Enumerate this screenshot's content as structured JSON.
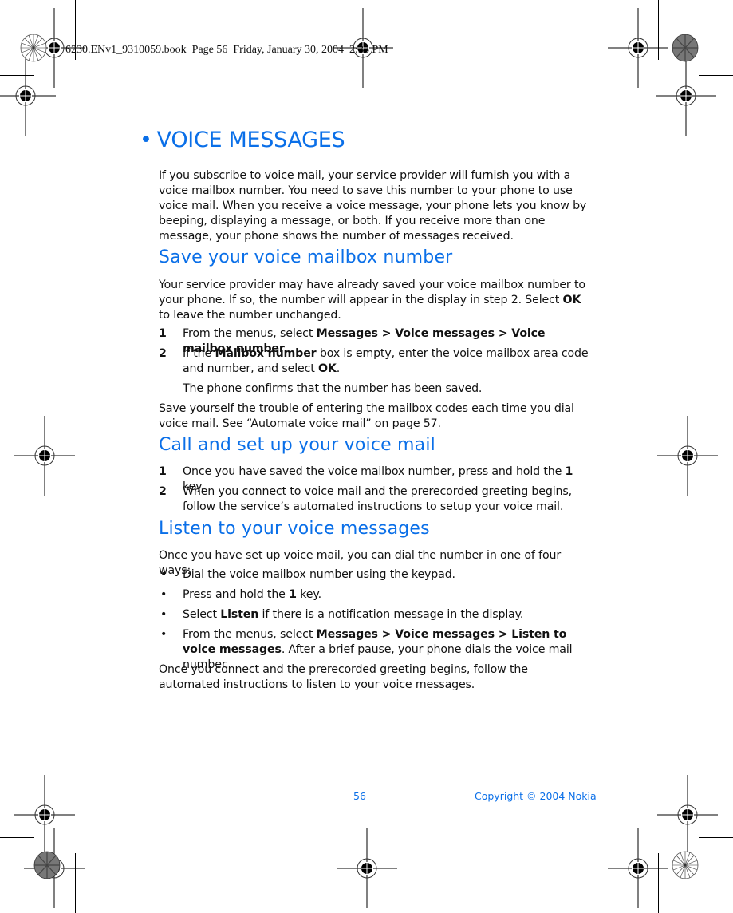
{
  "slug": "6230.ENv1_9310059.book  Page 56  Friday, January 30, 2004  2:33 PM",
  "title": {
    "bullet": "•",
    "text": "VOICE MESSAGES"
  },
  "intro": "If you subscribe to voice mail, your service provider will furnish you with a voice mailbox number. You need to save this number to your phone to use voice mail. When you receive a voice message, your phone lets you know by beeping, displaying a message, or both. If you receive more than one message, your phone shows the number of messages received.",
  "sections": {
    "save": {
      "heading": "Save your voice mailbox number",
      "para1_a": "Your service provider may have already saved your voice mailbox number to your phone. If so, the number will appear in the display in step 2. Select ",
      "para1_b": "OK",
      "para1_c": " to leave the number unchanged.",
      "step1": {
        "num": "1",
        "a": "From the menus, select ",
        "b": "Messages > Voice messages > Voice mailbox number",
        "c": "."
      },
      "step2": {
        "num": "2",
        "a": "If the ",
        "b": "Mailbox number",
        "c": " box is empty, enter the voice mailbox area code and number, and select ",
        "d": "OK",
        "e": "."
      },
      "confirm": "The phone confirms that the number has been saved.",
      "para2": "Save yourself the trouble of entering the mailbox codes each time you dial voice mail. See “Automate voice mail” on page 57."
    },
    "call": {
      "heading": "Call and set up your voice mail",
      "step1": {
        "num": "1",
        "a": "Once you have saved the voice mailbox number, press and hold the ",
        "b": "1",
        "c": " key."
      },
      "step2": {
        "num": "2",
        "a": "When you connect to voice mail and the prerecorded greeting begins, follow the service’s automated instructions to setup your voice mail."
      }
    },
    "listen": {
      "heading": "Listen to your voice messages",
      "intro": "Once you have set up voice mail, you can dial the number in one of four ways:",
      "bullet_glyph": "•",
      "b1": "Dial the voice mailbox number using the keypad.",
      "b2": {
        "a": "Press and hold the ",
        "b": "1",
        "c": " key."
      },
      "b3": {
        "a": "Select ",
        "b": "Listen",
        "c": " if there is a notification message in the display."
      },
      "b4": {
        "a": "From the menus, select ",
        "b": "Messages > Voice messages > Listen to voice messages",
        "c": ". After a brief pause, your phone dials the voice mail number."
      },
      "outro": "Once you connect and the prerecorded greeting begins, follow the automated instructions to listen to your voice messages."
    }
  },
  "footer": {
    "page_number": "56",
    "copyright": "Copyright © 2004 Nokia"
  },
  "colors": {
    "accent": "#0a6fe8",
    "text": "#111111"
  }
}
